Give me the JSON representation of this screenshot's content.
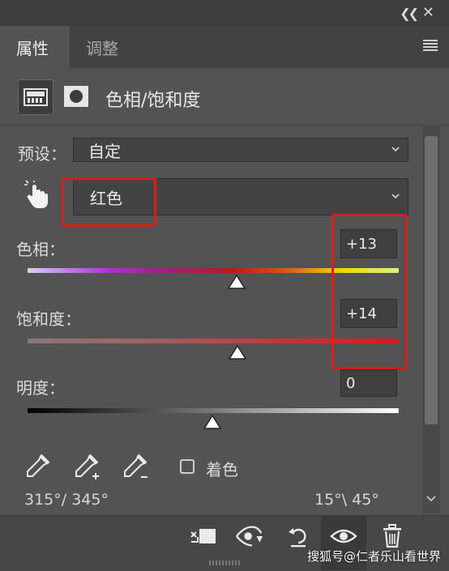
{
  "panel": {
    "tab_active": "属性",
    "tab_inactive": "调整",
    "title": "色相/饱和度"
  },
  "preset": {
    "label": "预设：",
    "value": "自定"
  },
  "channel": {
    "value": "红色"
  },
  "hue": {
    "label": "色相：",
    "value": "+13",
    "level": 0.5
  },
  "saturation": {
    "label": "饱和度：",
    "value": "+14",
    "level": 0.5
  },
  "lightness": {
    "label": "明度：",
    "value": "0",
    "level": 0.5
  },
  "colorize": {
    "label": "着色",
    "checked": false
  },
  "ranges": {
    "left": "315°/ 345°",
    "right": "15°\\ 45°"
  },
  "watermark": "搜狐号@仁者乐山看世界",
  "colors": {
    "highlight": "#e01b1b",
    "panel_bg": "#535353"
  },
  "icons": [
    "collapse-icon",
    "close-icon",
    "panel-menu-icon",
    "adjustment-layer-icon",
    "mask-icon",
    "targeted-adjust-icon",
    "eyedropper-icon",
    "eyedropper-add-icon",
    "eyedropper-subtract-icon",
    "clip-to-layer-icon",
    "view-previous-icon",
    "reset-icon",
    "visibility-icon",
    "delete-icon"
  ]
}
